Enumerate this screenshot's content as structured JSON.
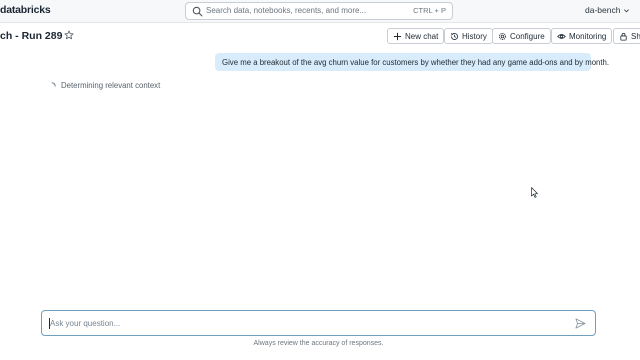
{
  "header": {
    "logo_text": "databricks",
    "search_placeholder": "Search data, notebooks, recents, and more...",
    "search_shortcut": "CTRL + P",
    "workspace": "da-bench"
  },
  "page": {
    "title": "ch - Run 289",
    "buttons": {
      "new_chat": "New chat",
      "history": "History",
      "configure": "Configure",
      "monitoring": "Monitoring",
      "share": "Sha"
    }
  },
  "conversation": {
    "user_message": "Give me a breakout of the avg churn value for customers by whether they had any game add-ons and by month.",
    "status": "Determining relevant context"
  },
  "composer": {
    "placeholder": "Ask your question...",
    "disclaimer": "Always review the accuracy of responses."
  },
  "icons": {
    "search": "search-icon",
    "star": "star-icon",
    "plus": "plus-icon",
    "history": "history-icon",
    "configure": "gear-icon",
    "monitoring": "eye-icon",
    "share": "lock-icon",
    "send": "send-icon",
    "chevron": "chevron-down-icon"
  },
  "colors": {
    "accent_border": "#6f9ebf",
    "user_bubble": "#d8ecfb",
    "topbar_bg": "#f7f8f9"
  }
}
